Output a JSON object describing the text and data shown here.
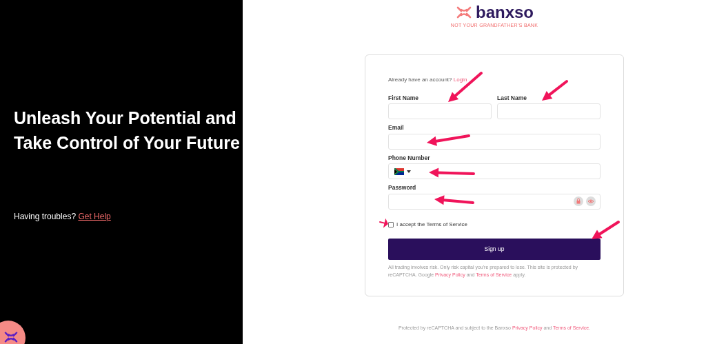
{
  "hero": {
    "heading": "Unleash Your Potential and Take Control of Your Future",
    "help_text": "Having troubles?",
    "help_link": "Get Help"
  },
  "brand": {
    "name": "banxso",
    "tagline": "NOT YOUR GRANDFATHER’S BANK"
  },
  "form": {
    "account_prompt": "Already have an account?",
    "login_link": "Login",
    "fields": [
      {
        "label": "First Name",
        "kind": "text"
      },
      {
        "label": "Last Name",
        "kind": "text"
      },
      {
        "label": "Email",
        "kind": "text"
      },
      {
        "label": "Phone Number",
        "kind": "phone"
      },
      {
        "label": "Password",
        "kind": "password"
      }
    ],
    "terms": {
      "label": "I accept the Terms of Service",
      "checked": false
    },
    "submit": "Sign up",
    "disclaimer": {
      "text": "All trading involves risk. Only risk capital you're prepared to lose. This site is protected by reCAPTCHA. Google",
      "privacy_link": "Privacy Policy",
      "joiner": "and",
      "terms_link": "Terms of Service",
      "suffix": "apply."
    }
  },
  "footer": {
    "text": "Protected by reCAPTCHA and subject to the Banxso",
    "privacy_link": "Privacy Policy",
    "joiner": "and",
    "terms_link": "Terms of Service",
    "suffix": "."
  }
}
